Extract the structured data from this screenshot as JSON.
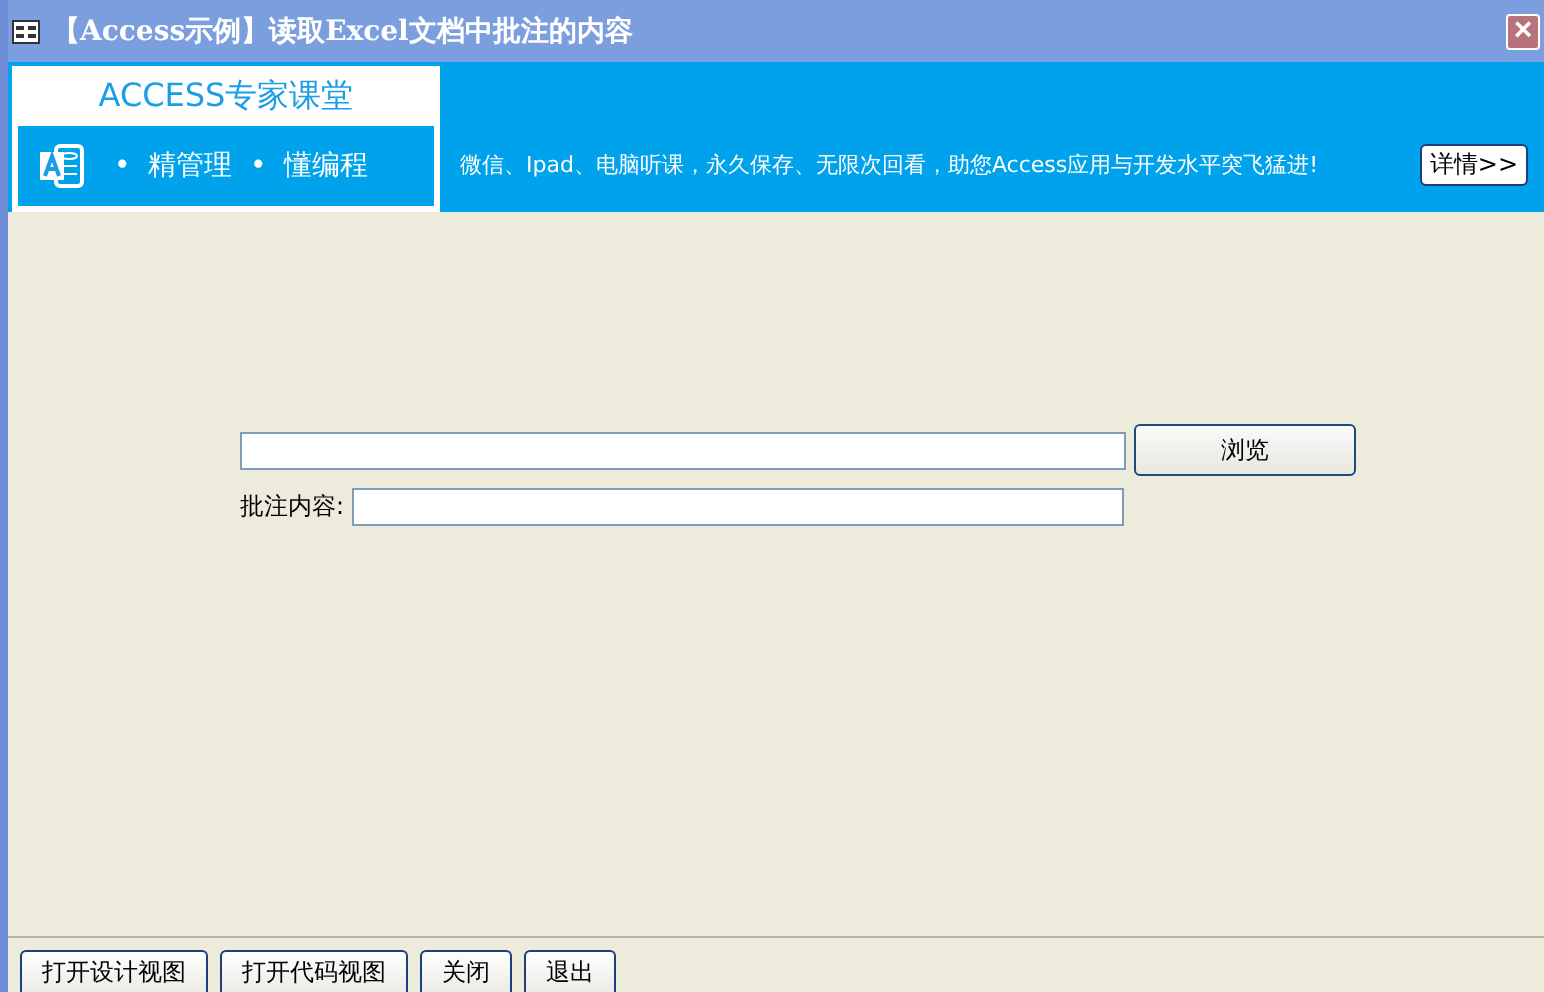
{
  "window": {
    "title": "【Access示例】读取Excel文档中批注的内容",
    "close": "×"
  },
  "banner": {
    "logo_title": "ACCESS专家课堂",
    "logo_tagline": "•  精管理  •  懂编程",
    "message": "微信、Ipad、电脑听课，永久保存、无限次回看，助您Access应用与开发水平突飞猛进!",
    "details_button": "详情>>"
  },
  "form": {
    "browse_button": "浏览",
    "comment_label": "批注内容:"
  },
  "footer_buttons": [
    "打开设计视图",
    "打开代码视图",
    "关闭",
    "退出"
  ]
}
